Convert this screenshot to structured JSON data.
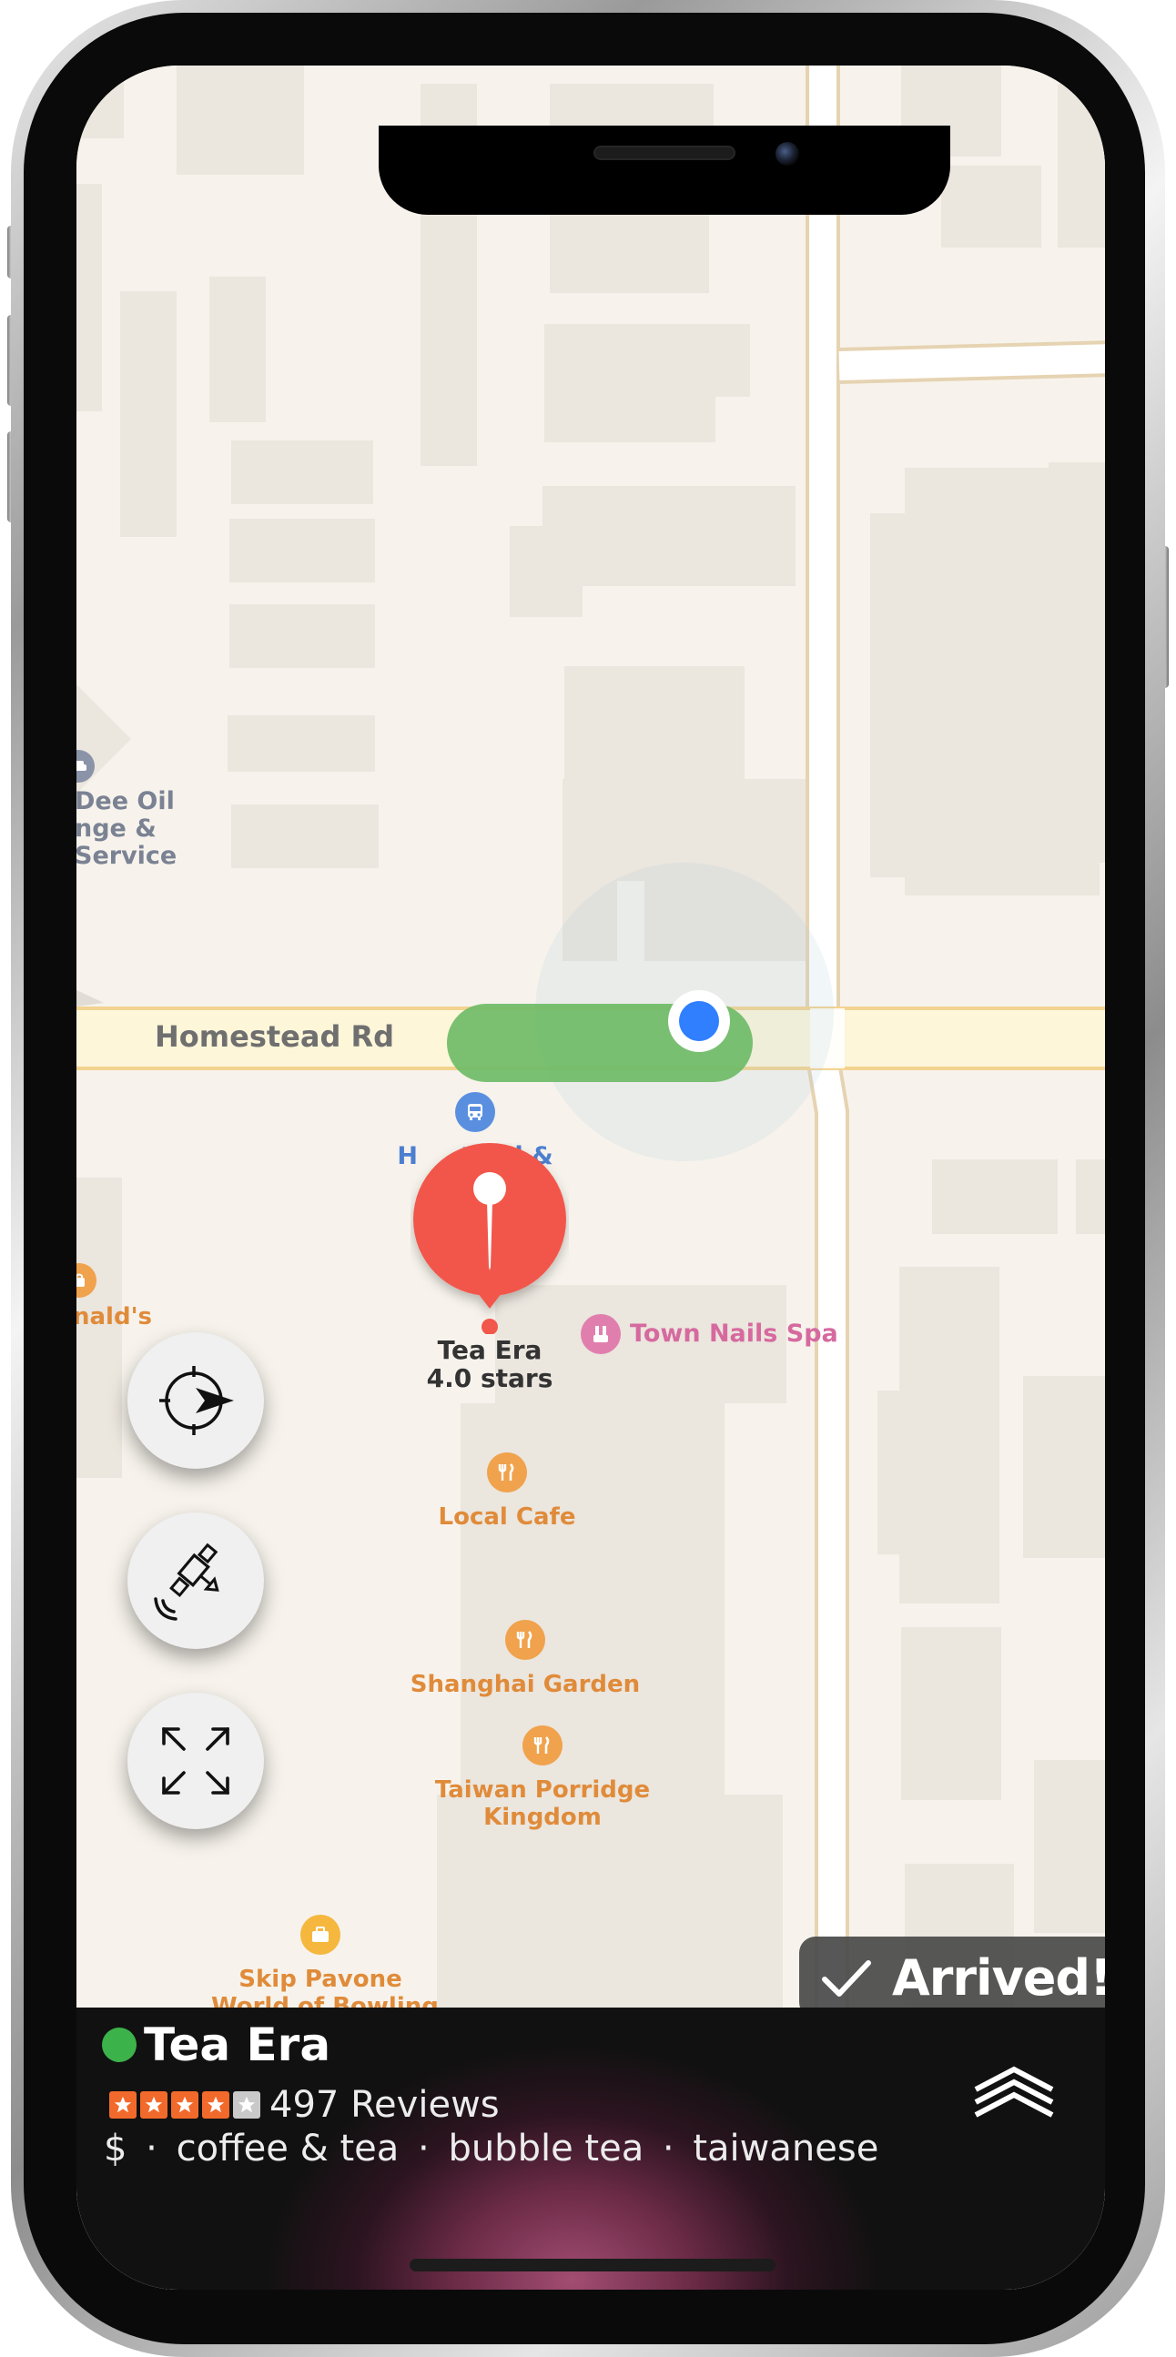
{
  "map": {
    "road": "Homestead Rd",
    "pois": {
      "dee_oil": "Dee Oil\nnge &\nService",
      "homestead_stop_line1": "H     tead &",
      "homestead_stop_line2": "g",
      "mcdonalds": "nald's",
      "town_nails": "Town Nails Spa",
      "local_cafe": "Local Cafe",
      "shanghai_garden": "Shanghai Garden",
      "taiwan_porridge": "Taiwan Porridge\nKingdom",
      "skip_pavone": "Skip Pavone\nWorld of Bowling"
    },
    "pin": {
      "name": "Tea Era",
      "rating_text": "4.0 stars"
    }
  },
  "controls": {
    "recenter_icon": "crosshair-arrow-icon",
    "satellite_icon": "satellite-icon",
    "expand_icon": "expand-arrows-icon"
  },
  "status": {
    "arrived_label": "Arrived!"
  },
  "place_card": {
    "name": "Tea Era",
    "open_status_color": "#3cb24a",
    "rating": 4.0,
    "rating_max": 5,
    "reviews": "497 Reviews",
    "price": "$",
    "categories": [
      "coffee & tea",
      "bubble tea",
      "taiwanese"
    ],
    "separator": "·"
  },
  "colors": {
    "pin": "#f2574b",
    "user_location": "#2f7fff",
    "route": "#6dbb66",
    "star_filled": "#f26a2b",
    "star_empty": "#c9c9c9"
  }
}
